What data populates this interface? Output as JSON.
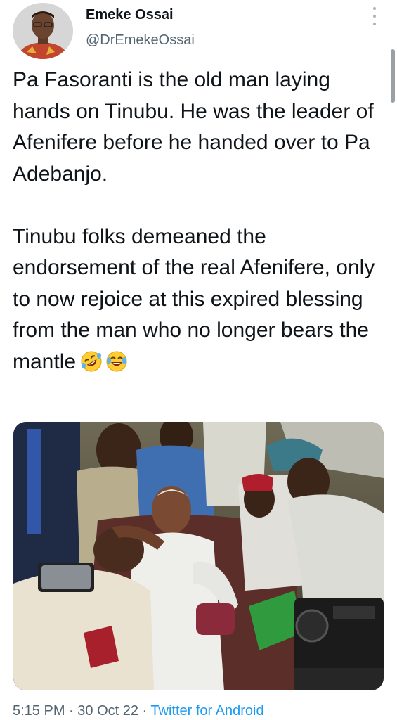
{
  "author": {
    "display_name": "Emeke Ossai",
    "handle": "@DrEmekeOssai"
  },
  "tweet": {
    "text": "Pa Fasoranti is the old man laying hands on Tinubu. He was the leader of Afenifere before he handed over to Pa Adebanjo.\n\nTinubu folks demeaned the endorsement of the real Afenifere, only to now rejoice at this expired blessing from the man who no longer bears the mantle",
    "emojis": [
      "rolling-on-floor-laughing-emoji",
      "tears-of-joy-emoji"
    ]
  },
  "meta": {
    "time": "5:15 PM",
    "separator_1": " · ",
    "date": "30 Oct 22",
    "separator_2": " · ",
    "client": "Twitter for Android"
  },
  "colors": {
    "text": "#0f1419",
    "secondary": "#536471",
    "link": "#1d9bf0"
  }
}
